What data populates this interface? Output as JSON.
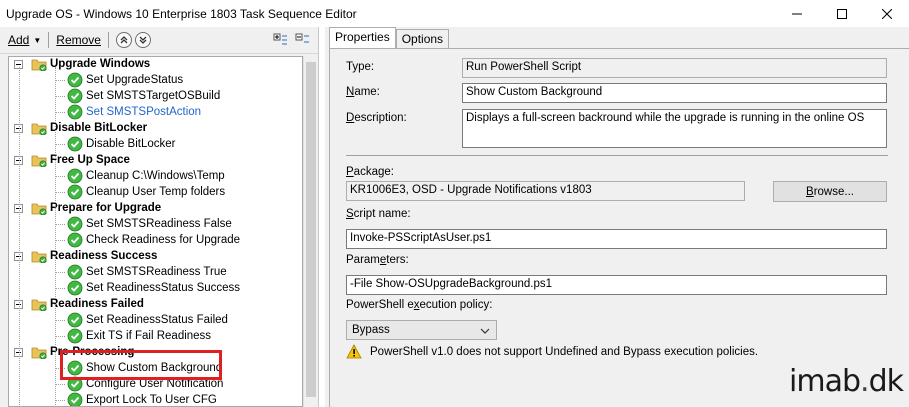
{
  "window": {
    "title": "Upgrade OS - Windows 10 Enterprise 1803 Task Sequence Editor"
  },
  "toolbar": {
    "add_label": "Add",
    "remove_label": "Remove"
  },
  "tree": {
    "items": [
      {
        "label": "Upgrade Windows",
        "type": "group"
      },
      {
        "label": "Set UpgradeStatus",
        "type": "step"
      },
      {
        "label": "Set SMSTSTargetOSBuild",
        "type": "step"
      },
      {
        "label": "Set SMSTSPostAction",
        "type": "step-link"
      },
      {
        "label": "Disable BitLocker",
        "type": "group"
      },
      {
        "label": "Disable BitLocker",
        "type": "step"
      },
      {
        "label": "Free Up Space",
        "type": "group"
      },
      {
        "label": "Cleanup C:\\Windows\\Temp",
        "type": "step"
      },
      {
        "label": "Cleanup User Temp folders",
        "type": "step"
      },
      {
        "label": "Prepare for Upgrade",
        "type": "group"
      },
      {
        "label": "Set SMSTSReadiness False",
        "type": "step"
      },
      {
        "label": "Check Readiness for Upgrade",
        "type": "step"
      },
      {
        "label": "Readiness Success",
        "type": "group"
      },
      {
        "label": "Set SMSTSReadiness True",
        "type": "step"
      },
      {
        "label": "Set ReadinessStatus Success",
        "type": "step"
      },
      {
        "label": "Readiness Failed",
        "type": "group"
      },
      {
        "label": "Set ReadinessStatus Failed",
        "type": "step"
      },
      {
        "label": "Exit TS if Fail Readiness",
        "type": "step"
      },
      {
        "label": "Pre-Processing",
        "type": "group"
      },
      {
        "label": "Show Custom Background",
        "type": "step"
      },
      {
        "label": "Configure User Notification",
        "type": "step"
      },
      {
        "label": "Export Lock To User CFG",
        "type": "step"
      }
    ]
  },
  "tabs": {
    "properties": "Properties",
    "options": "Options"
  },
  "properties": {
    "type_label": "Type:",
    "type_value": "Run PowerShell Script",
    "name_label": "Name:",
    "name_value": "Show Custom Background",
    "description_label": "Description:",
    "description_value": "Displays a full-screen backround while the upgrade is running in the online OS",
    "package_label": "Package:",
    "package_value": "KR1006E3, OSD - Upgrade Notifications v1803",
    "browse_label": "Browse...",
    "script_label": "Script name:",
    "script_value": "Invoke-PSScriptAsUser.ps1",
    "parameters_label": "Parameters:",
    "parameters_value": "-File Show-OSUpgradeBackground.ps1",
    "policy_label": "PowerShell execution policy:",
    "policy_value": "Bypass",
    "warning_text": "PowerShell v1.0 does not support Undefined and Bypass execution policies."
  },
  "watermark": {
    "brand": "imab",
    "dot": ".",
    "tld": "dk"
  }
}
